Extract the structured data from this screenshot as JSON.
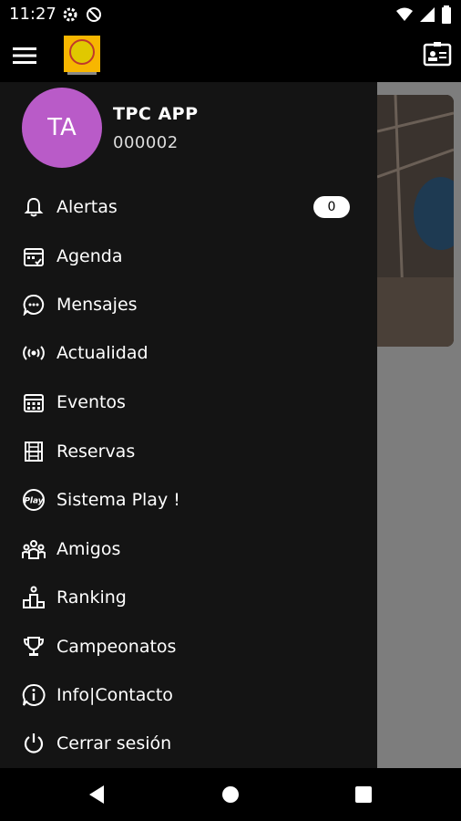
{
  "status": {
    "time": "11:27"
  },
  "user": {
    "initials": "TA",
    "name": "TPC APP",
    "code": "000002"
  },
  "menu": [
    {
      "label": "Alertas",
      "icon": "bell-icon",
      "badge": "0"
    },
    {
      "label": "Agenda",
      "icon": "calendar-check-icon"
    },
    {
      "label": "Mensajes",
      "icon": "chat-bubble-icon"
    },
    {
      "label": "Actualidad",
      "icon": "broadcast-icon"
    },
    {
      "label": "Eventos",
      "icon": "calendar-grid-icon"
    },
    {
      "label": "Reservas",
      "icon": "court-icon"
    },
    {
      "label": "Sistema Play !",
      "icon": "play-badge-icon"
    },
    {
      "label": "Amigos",
      "icon": "friends-icon"
    },
    {
      "label": "Ranking",
      "icon": "ranking-podium-icon"
    },
    {
      "label": "Campeonatos",
      "icon": "trophy-icon"
    },
    {
      "label": "Info|Contacto",
      "icon": "info-icon"
    },
    {
      "label": "Cerrar sesión",
      "icon": "power-icon"
    }
  ],
  "colors": {
    "avatar": "#b95bc8",
    "drawer": "#141414"
  }
}
